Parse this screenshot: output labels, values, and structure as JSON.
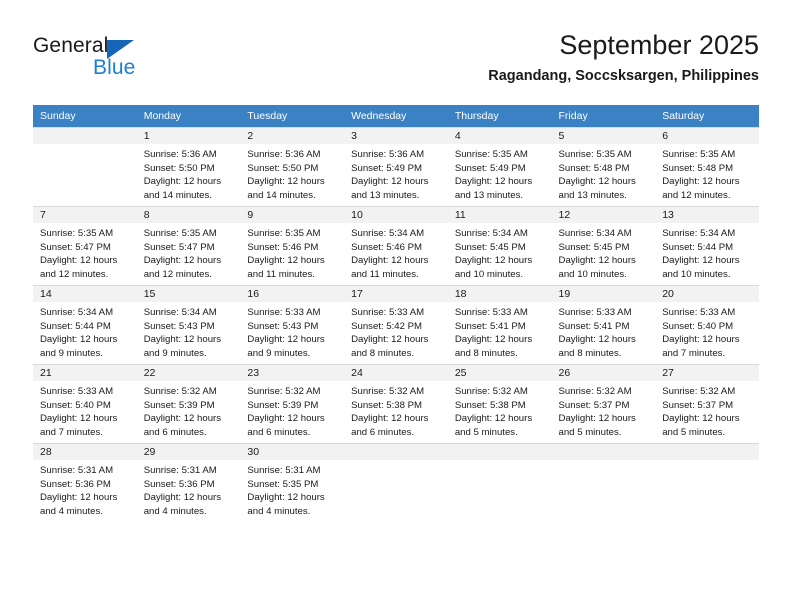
{
  "brand": {
    "name_part1": "General",
    "name_part2": "Blue",
    "accent_color": "#1b7fd4",
    "triangle_color": "#1565b8"
  },
  "header": {
    "title": "September 2025",
    "subtitle": "Ragandang, Soccsksargen, Philippines"
  },
  "theme": {
    "header_row_bg": "#3b82c4",
    "daynum_bg": "#f2f2f2",
    "text_color": "#1a1a1a"
  },
  "weekday_headers": [
    "Sunday",
    "Monday",
    "Tuesday",
    "Wednesday",
    "Thursday",
    "Friday",
    "Saturday"
  ],
  "weeks": [
    [
      {
        "day": "",
        "lines": []
      },
      {
        "day": "1",
        "lines": [
          "Sunrise: 5:36 AM",
          "Sunset: 5:50 PM",
          "Daylight: 12 hours",
          "and 14 minutes."
        ]
      },
      {
        "day": "2",
        "lines": [
          "Sunrise: 5:36 AM",
          "Sunset: 5:50 PM",
          "Daylight: 12 hours",
          "and 14 minutes."
        ]
      },
      {
        "day": "3",
        "lines": [
          "Sunrise: 5:36 AM",
          "Sunset: 5:49 PM",
          "Daylight: 12 hours",
          "and 13 minutes."
        ]
      },
      {
        "day": "4",
        "lines": [
          "Sunrise: 5:35 AM",
          "Sunset: 5:49 PM",
          "Daylight: 12 hours",
          "and 13 minutes."
        ]
      },
      {
        "day": "5",
        "lines": [
          "Sunrise: 5:35 AM",
          "Sunset: 5:48 PM",
          "Daylight: 12 hours",
          "and 13 minutes."
        ]
      },
      {
        "day": "6",
        "lines": [
          "Sunrise: 5:35 AM",
          "Sunset: 5:48 PM",
          "Daylight: 12 hours",
          "and 12 minutes."
        ]
      }
    ],
    [
      {
        "day": "7",
        "lines": [
          "Sunrise: 5:35 AM",
          "Sunset: 5:47 PM",
          "Daylight: 12 hours",
          "and 12 minutes."
        ]
      },
      {
        "day": "8",
        "lines": [
          "Sunrise: 5:35 AM",
          "Sunset: 5:47 PM",
          "Daylight: 12 hours",
          "and 12 minutes."
        ]
      },
      {
        "day": "9",
        "lines": [
          "Sunrise: 5:35 AM",
          "Sunset: 5:46 PM",
          "Daylight: 12 hours",
          "and 11 minutes."
        ]
      },
      {
        "day": "10",
        "lines": [
          "Sunrise: 5:34 AM",
          "Sunset: 5:46 PM",
          "Daylight: 12 hours",
          "and 11 minutes."
        ]
      },
      {
        "day": "11",
        "lines": [
          "Sunrise: 5:34 AM",
          "Sunset: 5:45 PM",
          "Daylight: 12 hours",
          "and 10 minutes."
        ]
      },
      {
        "day": "12",
        "lines": [
          "Sunrise: 5:34 AM",
          "Sunset: 5:45 PM",
          "Daylight: 12 hours",
          "and 10 minutes."
        ]
      },
      {
        "day": "13",
        "lines": [
          "Sunrise: 5:34 AM",
          "Sunset: 5:44 PM",
          "Daylight: 12 hours",
          "and 10 minutes."
        ]
      }
    ],
    [
      {
        "day": "14",
        "lines": [
          "Sunrise: 5:34 AM",
          "Sunset: 5:44 PM",
          "Daylight: 12 hours",
          "and 9 minutes."
        ]
      },
      {
        "day": "15",
        "lines": [
          "Sunrise: 5:34 AM",
          "Sunset: 5:43 PM",
          "Daylight: 12 hours",
          "and 9 minutes."
        ]
      },
      {
        "day": "16",
        "lines": [
          "Sunrise: 5:33 AM",
          "Sunset: 5:43 PM",
          "Daylight: 12 hours",
          "and 9 minutes."
        ]
      },
      {
        "day": "17",
        "lines": [
          "Sunrise: 5:33 AM",
          "Sunset: 5:42 PM",
          "Daylight: 12 hours",
          "and 8 minutes."
        ]
      },
      {
        "day": "18",
        "lines": [
          "Sunrise: 5:33 AM",
          "Sunset: 5:41 PM",
          "Daylight: 12 hours",
          "and 8 minutes."
        ]
      },
      {
        "day": "19",
        "lines": [
          "Sunrise: 5:33 AM",
          "Sunset: 5:41 PM",
          "Daylight: 12 hours",
          "and 8 minutes."
        ]
      },
      {
        "day": "20",
        "lines": [
          "Sunrise: 5:33 AM",
          "Sunset: 5:40 PM",
          "Daylight: 12 hours",
          "and 7 minutes."
        ]
      }
    ],
    [
      {
        "day": "21",
        "lines": [
          "Sunrise: 5:33 AM",
          "Sunset: 5:40 PM",
          "Daylight: 12 hours",
          "and 7 minutes."
        ]
      },
      {
        "day": "22",
        "lines": [
          "Sunrise: 5:32 AM",
          "Sunset: 5:39 PM",
          "Daylight: 12 hours",
          "and 6 minutes."
        ]
      },
      {
        "day": "23",
        "lines": [
          "Sunrise: 5:32 AM",
          "Sunset: 5:39 PM",
          "Daylight: 12 hours",
          "and 6 minutes."
        ]
      },
      {
        "day": "24",
        "lines": [
          "Sunrise: 5:32 AM",
          "Sunset: 5:38 PM",
          "Daylight: 12 hours",
          "and 6 minutes."
        ]
      },
      {
        "day": "25",
        "lines": [
          "Sunrise: 5:32 AM",
          "Sunset: 5:38 PM",
          "Daylight: 12 hours",
          "and 5 minutes."
        ]
      },
      {
        "day": "26",
        "lines": [
          "Sunrise: 5:32 AM",
          "Sunset: 5:37 PM",
          "Daylight: 12 hours",
          "and 5 minutes."
        ]
      },
      {
        "day": "27",
        "lines": [
          "Sunrise: 5:32 AM",
          "Sunset: 5:37 PM",
          "Daylight: 12 hours",
          "and 5 minutes."
        ]
      }
    ],
    [
      {
        "day": "28",
        "lines": [
          "Sunrise: 5:31 AM",
          "Sunset: 5:36 PM",
          "Daylight: 12 hours",
          "and 4 minutes."
        ]
      },
      {
        "day": "29",
        "lines": [
          "Sunrise: 5:31 AM",
          "Sunset: 5:36 PM",
          "Daylight: 12 hours",
          "and 4 minutes."
        ]
      },
      {
        "day": "30",
        "lines": [
          "Sunrise: 5:31 AM",
          "Sunset: 5:35 PM",
          "Daylight: 12 hours",
          "and 4 minutes."
        ]
      },
      {
        "day": "",
        "lines": []
      },
      {
        "day": "",
        "lines": []
      },
      {
        "day": "",
        "lines": []
      },
      {
        "day": "",
        "lines": []
      }
    ]
  ]
}
